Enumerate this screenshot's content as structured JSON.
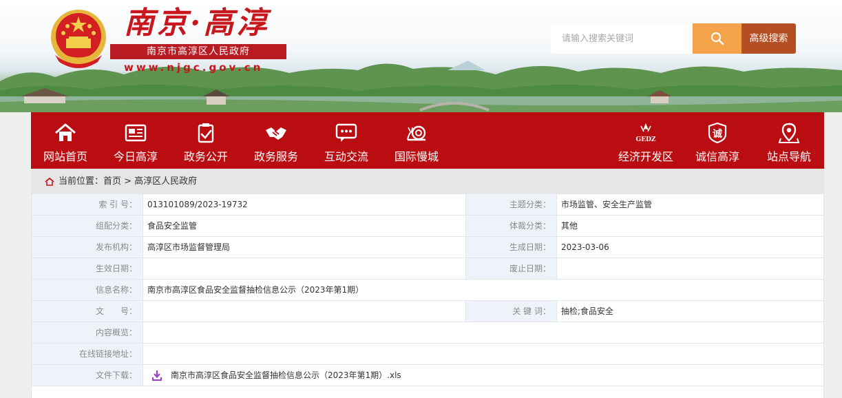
{
  "header": {
    "logo_title": "南京·高淳",
    "logo_subtitle": "南京市高淳区人民政府",
    "logo_url": "www.njgc.gov.cn",
    "search_placeholder": "请输入搜索关键词",
    "search_icon": "search-icon",
    "advanced_search_label": "高级搜索",
    "colors": {
      "brand_red": "#ba0d12",
      "search_orange": "#f5a34a",
      "advanced_brown": "#b54e22"
    }
  },
  "nav": {
    "items": [
      {
        "label": "网站首页",
        "icon": "home-icon"
      },
      {
        "label": "今日高淳",
        "icon": "newspaper-icon"
      },
      {
        "label": "政务公开",
        "icon": "clipboard-check-icon"
      },
      {
        "label": "政务服务",
        "icon": "handshake-icon"
      },
      {
        "label": "互动交流",
        "icon": "chat-bubble-icon"
      },
      {
        "label": "国际慢城",
        "icon": "snail-icon"
      },
      {
        "label": "经济开发区",
        "icon": "gedz-logo-icon",
        "icon_text": "GEDZ"
      },
      {
        "label": "诚信高淳",
        "icon": "credit-seal-icon",
        "icon_text": "诚"
      },
      {
        "label": "站点导航",
        "icon": "location-pin-icon"
      }
    ]
  },
  "breadcrumb": {
    "text": "当前位置：首页 > 高淳区人民政府"
  },
  "info": {
    "index_label": "索 引 号：",
    "index_value": "013101089/2023-19732",
    "topic_label": "主题分类：",
    "topic_value": "市场监管、安全生产监管",
    "group_label": "组配分类：",
    "group_value": "食品安全监管",
    "genre_label": "体裁分类：",
    "genre_value": "其他",
    "publisher_label": "发布机构：",
    "publisher_value": "高淳区市场监督管理局",
    "created_label": "生成日期：",
    "created_value": "2023-03-06",
    "effective_label": "生效日期：",
    "effective_value": "",
    "expired_label": "废止日期：",
    "expired_value": "",
    "name_label": "信息名称：",
    "name_value": "南京市高淳区食品安全监督抽检信息公示（2023年第1期）",
    "docno_label": "文　　号：",
    "docno_value": "",
    "keywords_label": "关 键 词：",
    "keywords_value": "抽检;食品安全",
    "summary_label": "内容概览：",
    "summary_value": "",
    "link_label": "在线链接地址：",
    "link_value": "",
    "download_label": "文件下载：",
    "download_file": "南京市高淳区食品安全监督抽检信息公示（2023年第1期）.xls"
  }
}
